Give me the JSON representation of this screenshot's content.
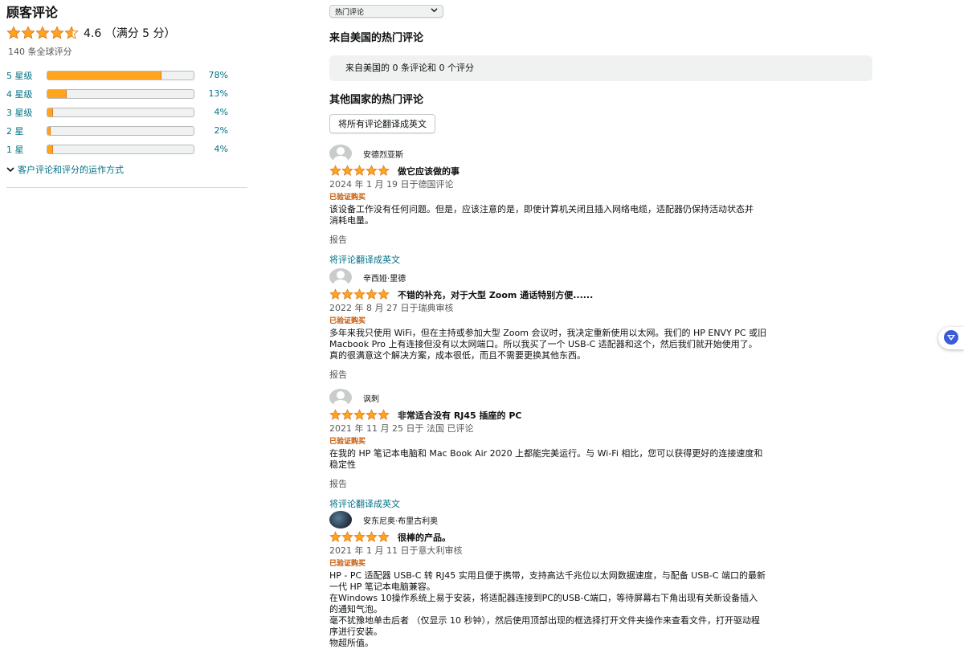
{
  "summary": {
    "heading": "顾客评论",
    "average_rating": 4.6,
    "rating_text": "4.6 （满分 5 分）",
    "global_count": "140 条全球评分",
    "histogram": [
      {
        "label": "5 星级",
        "percent": 78,
        "percent_text": "78%"
      },
      {
        "label": "4 星级",
        "percent": 13,
        "percent_text": "13%"
      },
      {
        "label": "3 星级",
        "percent": 4,
        "percent_text": "4%"
      },
      {
        "label": "2 星",
        "percent": 2,
        "percent_text": "2%"
      },
      {
        "label": "1 星",
        "percent": 4,
        "percent_text": "4%"
      }
    ],
    "how_it_works": "客户评论和评分的运作方式"
  },
  "sort": {
    "selected": "热门评论"
  },
  "us_section": {
    "heading": "来自美国的热门评论",
    "empty_text": "来自美国的 0 条评论和 0 个评分"
  },
  "other_section": {
    "heading": "其他国家的热门评论",
    "translate_all": "将所有评论翻译成英文"
  },
  "reviews": [
    {
      "name": "安德烈亚斯",
      "rating": 5,
      "title": "做它应该做的事",
      "date": "2024 年 1 月 19 日于德国评论",
      "verified": "已验证购买",
      "body": [
        "该设备工作没有任何问题。但是，应该注意的是，即使计算机关闭且插入网络电缆，适配器仍保持活动状态并",
        "消耗电量。"
      ],
      "report": "报告",
      "translate": "将评论翻译成英文",
      "avatar": "default"
    },
    {
      "name": "辛西娅·里德",
      "rating": 5,
      "title": "不错的补充，对于大型 Zoom 通话特别方便......",
      "date": "2022 年 8 月 27 日于瑞典审核",
      "verified": "已验证购买",
      "body": [
        "多年来我只使用 WiFi，但在主持或参加大型 Zoom 会议时，我决定重新使用以太网。我们的 HP ENVY PC 或旧",
        "Macbook Pro 上有连接但没有以太网端口。所以我买了一个 USB-C 适配器和这个，然后我们就开始使用了。",
        "真的很满意这个解决方案，成本很低，而且不需要更换其他东西。"
      ],
      "report": "报告",
      "translate": "",
      "avatar": "default"
    },
    {
      "name": "讽刺",
      "rating": 5,
      "title": "非常适合没有 RJ45 插座的 PC",
      "date": "2021 年 11 月 25 日于 法国 已评论",
      "verified": "已验证购买",
      "body": [
        "在我的 HP 笔记本电脑和 Mac Book Air 2020 上都能完美运行。与 Wi-Fi 相比，您可以获得更好的连接速度和",
        "稳定性"
      ],
      "report": "报告",
      "translate": "将评论翻译成英文",
      "avatar": "default"
    },
    {
      "name": "安东尼奥·布里古利奥",
      "rating": 5,
      "title": "很棒的产品。",
      "date": "2021 年 1 月 11 日于意大利审核",
      "verified": "已验证购买",
      "body": [
        "HP - PC 适配器 USB-C 转 RJ45 实用且便于携带，支持高达千兆位以太网数据速度，与配备 USB-C 端口的最新",
        "一代 HP 笔记本电脑兼容。",
        "在Windows 10操作系统上易于安装，将适配器连接到PC的USB-C端口，等待屏幕右下角出现有关新设备插入",
        "的通知气泡。",
        "毫不犹豫地单击后者 （仅显示 10 秒钟），然后使用顶部出现的框选择打开文件夹操作来查看文件，打开驱动程",
        "序进行安装。",
        "物超所值。"
      ],
      "report": "",
      "translate": "",
      "avatar": "photo"
    }
  ]
}
